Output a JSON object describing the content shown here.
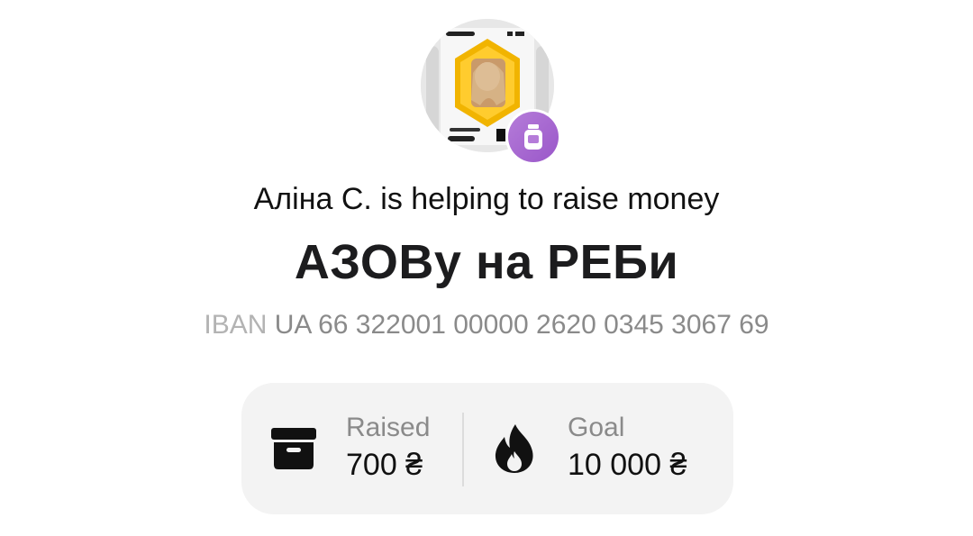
{
  "jar": {
    "owner_line": "Аліна С. is helping to raise money",
    "title": "АЗОВу на РЕБи",
    "iban_label": "IBAN",
    "iban_value": "UA 66 322001 00000 2620 0345 3067 69"
  },
  "stats": {
    "raised": {
      "label": "Raised",
      "value": "700 ₴",
      "icon": "archive-box-icon"
    },
    "goal": {
      "label": "Goal",
      "value": "10 000 ₴",
      "icon": "flame-icon"
    }
  },
  "colors": {
    "badge": "#9a57c9",
    "stats_bg": "#f3f3f3",
    "muted_text": "#8a8a8a"
  }
}
